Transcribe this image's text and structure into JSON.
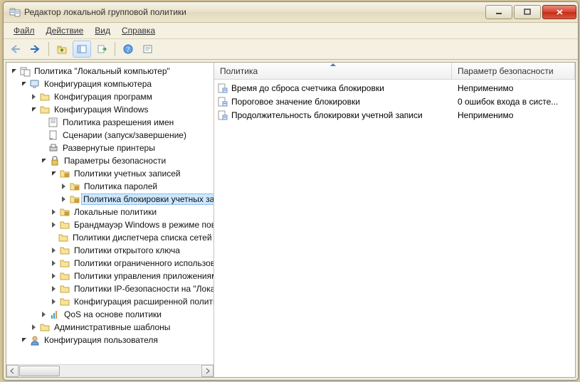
{
  "window": {
    "title": "Редактор локальной групповой политики"
  },
  "menu": {
    "file": "Файл",
    "action": "Действие",
    "view": "Вид",
    "help": "Справка"
  },
  "tree": {
    "root": "Политика \"Локальный компьютер\"",
    "computer_config": "Конфигурация компьютера",
    "program_config": "Конфигурация программ",
    "windows_config": "Конфигурация Windows",
    "name_resolution": "Политика разрешения имен",
    "scripts": "Сценарии (запуск/завершение)",
    "deployed_printers": "Развернутые принтеры",
    "security_settings": "Параметры безопасности",
    "account_policies": "Политики учетных записей",
    "password_policy": "Политика паролей",
    "lockout_policy": "Политика блокировки учетных записей",
    "local_policies": "Локальные политики",
    "firewall": "Брандмауэр Windows в режиме повышенной безопасности",
    "network_list": "Политики диспетчера списка сетей",
    "public_key": "Политики открытого ключа",
    "software_restriction": "Политики ограниченного использования программ",
    "app_control": "Политики управления приложениями",
    "ip_security": "Политики IP-безопасности на \"Локальный компьютер\"",
    "advanced_audit": "Конфигурация расширенной политики аудита",
    "qos": "QoS на основе политики",
    "admin_templates": "Административные шаблоны",
    "user_config": "Конфигурация пользователя"
  },
  "list": {
    "col_policy": "Политика",
    "col_param": "Параметр безопасности",
    "rows": [
      {
        "name": "Время до сброса счетчика блокировки",
        "value": "Неприменимо"
      },
      {
        "name": "Пороговое значение блокировки",
        "value": "0 ошибок входа в систе..."
      },
      {
        "name": "Продолжительность блокировки учетной записи",
        "value": "Неприменимо"
      }
    ]
  }
}
